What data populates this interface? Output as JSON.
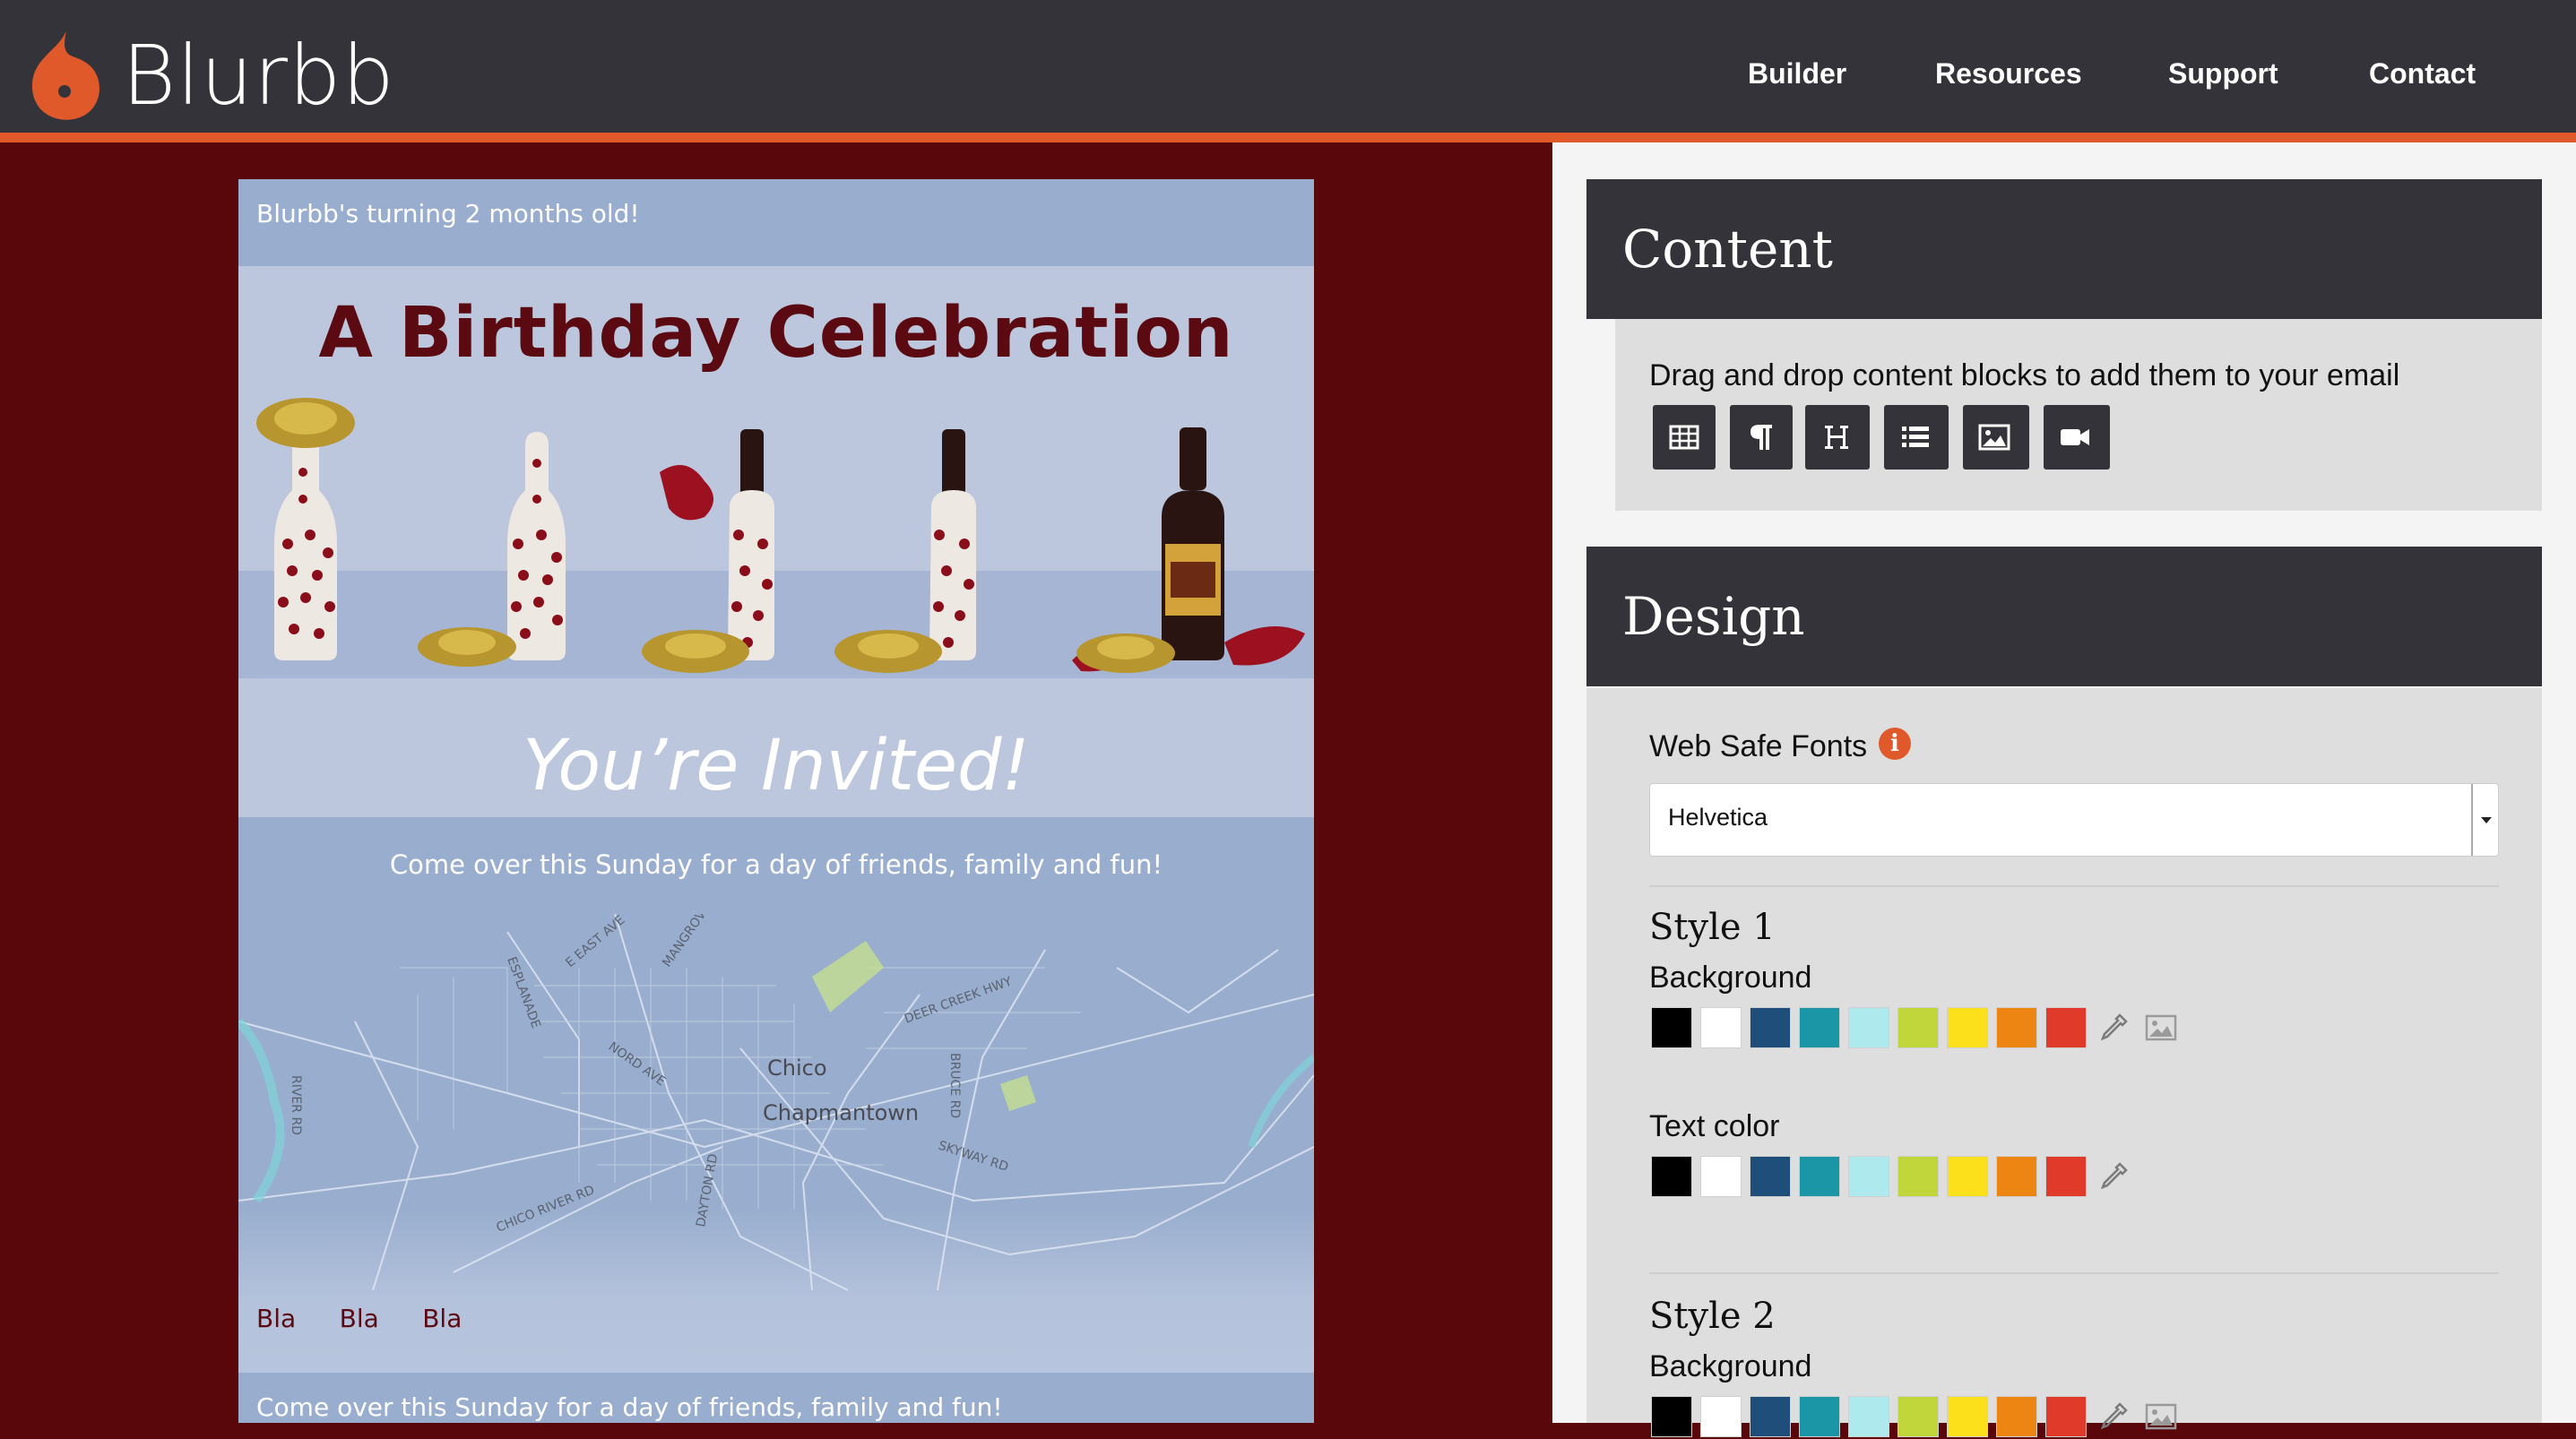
{
  "nav": {
    "brand": "Blurbb",
    "links": [
      "Builder",
      "Resources",
      "Support",
      "Contact"
    ]
  },
  "email": {
    "top_text": "Blurbb's turning 2 months old!",
    "hero_title": "A Birthday Celebration",
    "invited_title": "You’re Invited!",
    "invited_sub": "Come over this Sunday for a day of friends, family and fun!",
    "map_labels": [
      "Chico",
      "Chapmantown",
      "DEER CREEK HWY",
      "NORD AVE",
      "CHICO RIVER RD",
      "SKYWAY RD",
      "BRUCE RD",
      "DAYTON RD",
      "RIVER RD",
      "E EAST AVE",
      "MANGROVE",
      "ESPLANADE"
    ],
    "bla_items": [
      "Bla",
      "Bla",
      "Bla"
    ],
    "bottom_text": "Come over this Sunday for a day of friends, family and fun!"
  },
  "content_card": {
    "title": "Content",
    "description": "Drag and drop content blocks to add them to your email",
    "blocks": [
      "table-icon",
      "paragraph-icon",
      "heading-icon",
      "list-icon",
      "image-icon",
      "video-icon"
    ]
  },
  "design_card": {
    "title": "Design",
    "fonts_label": "Web Safe Fonts",
    "font_value": "Helvetica",
    "style1": {
      "title": "Style 1",
      "background_label": "Background",
      "text_color_label": "Text color"
    },
    "style2": {
      "title": "Style 2",
      "background_label": "Background"
    },
    "palette": [
      "#000000",
      "#ffffff",
      "#1f4e7a",
      "#1a96a6",
      "#aee9ee",
      "#c0d63a",
      "#fce01c",
      "#ec8511",
      "#df3a2a"
    ]
  },
  "colors": {
    "nav_bg": "#333339",
    "accent": "#e0592b",
    "preview_bg": "#5a070b",
    "email_blue": "#99aece",
    "title_maroon": "#5c0a12"
  }
}
